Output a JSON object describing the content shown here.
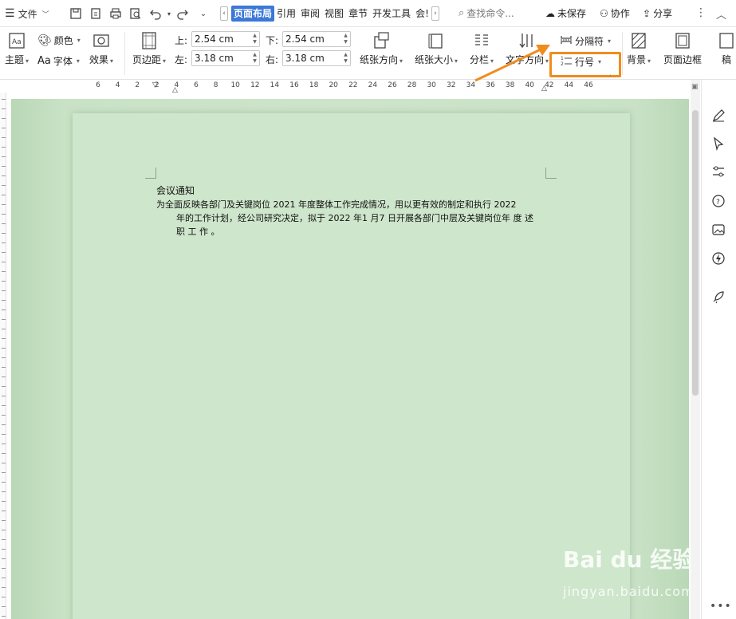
{
  "menu": {
    "file_label": "文件"
  },
  "tabs": [
    {
      "label": "页面布局",
      "active": true
    },
    {
      "label": "引用"
    },
    {
      "label": "审阅"
    },
    {
      "label": "视图"
    },
    {
      "label": "章节"
    },
    {
      "label": "开发工具"
    },
    {
      "label": "会!"
    }
  ],
  "search": {
    "placeholder": "查找命令..."
  },
  "status": {
    "unsaved": "未保存",
    "collab": "协作",
    "share": "分享"
  },
  "ribbon": {
    "theme": "主题",
    "color": "颜色",
    "font": "字体",
    "effect": "效果",
    "margins": "页边距",
    "margin_top_label": "上:",
    "margin_top_value": "2.54 cm",
    "margin_bottom_label": "下:",
    "margin_bottom_value": "2.54 cm",
    "margin_left_label": "左:",
    "margin_left_value": "3.18 cm",
    "margin_right_label": "右:",
    "margin_right_value": "3.18 cm",
    "orientation": "纸张方向",
    "size": "纸张大小",
    "columns": "分栏",
    "text_direction": "文字方向",
    "breaks": "分隔符",
    "line_numbers": "行号",
    "background": "背景",
    "page_border": "页面边框",
    "overflow": "稿"
  },
  "ruler": {
    "numbers": [
      "6",
      "4",
      "2",
      "2",
      "4",
      "6",
      "8",
      "10",
      "12",
      "14",
      "16",
      "18",
      "20",
      "22",
      "24",
      "26",
      "28",
      "30",
      "32",
      "34",
      "36",
      "38",
      "40",
      "42",
      "44",
      "46"
    ]
  },
  "document": {
    "title": "会议通知",
    "line1": "为全面反映各部门及关键岗位 2021 年度整体工作完成情况，用以更有效的制定和执行 2022",
    "line2": "年的工作计划，经公司研究决定，拟于 2022 年1 月7 日开展各部门中层及关键岗位年 度 述",
    "line3": "职 工 作 。"
  },
  "watermark": {
    "brand": "Bai du 经验",
    "url": "jingyan.baidu.com"
  },
  "colors": {
    "accent": "#3b78d8",
    "highlight": "#f08c1e",
    "page_bg": "#cee6cb"
  }
}
